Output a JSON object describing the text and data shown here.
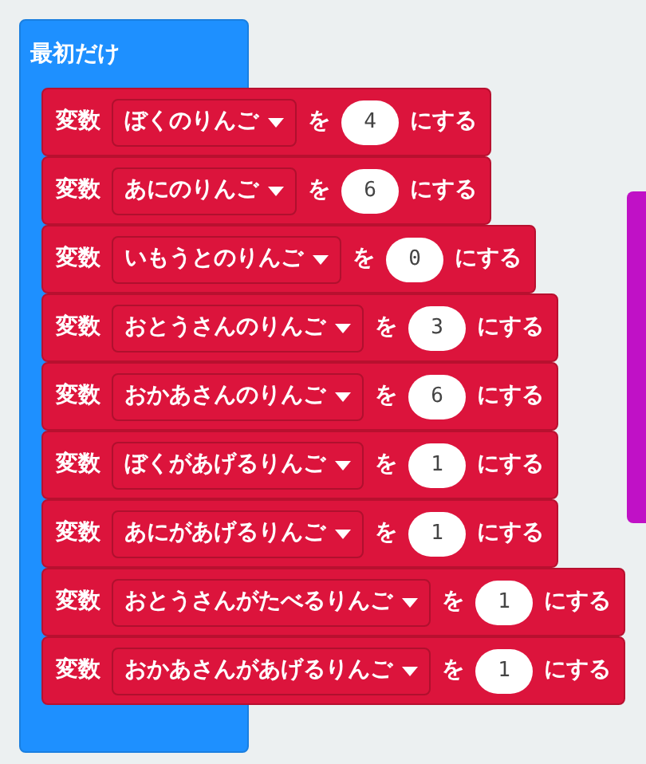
{
  "event_block": {
    "title": "最初だけ"
  },
  "blocks": [
    {
      "keyword": "変数",
      "variable": "ぼくのりんご",
      "particle": "を",
      "value": "4",
      "suffix": "にする"
    },
    {
      "keyword": "変数",
      "variable": "あにのりんご",
      "particle": "を",
      "value": "6",
      "suffix": "にする"
    },
    {
      "keyword": "変数",
      "variable": "いもうとのりんご",
      "particle": "を",
      "value": "0",
      "suffix": "にする"
    },
    {
      "keyword": "変数",
      "variable": "おとうさんのりんご",
      "particle": "を",
      "value": "3",
      "suffix": "にする"
    },
    {
      "keyword": "変数",
      "variable": "おかあさんのりんご",
      "particle": "を",
      "value": "6",
      "suffix": "にする"
    },
    {
      "keyword": "変数",
      "variable": "ぼくがあげるりんご",
      "particle": "を",
      "value": "1",
      "suffix": "にする"
    },
    {
      "keyword": "変数",
      "variable": "あにがあげるりんご",
      "particle": "を",
      "value": "1",
      "suffix": "にする"
    },
    {
      "keyword": "変数",
      "variable": "おとうさんがたべるりんご",
      "particle": "を",
      "value": "1",
      "suffix": "にする"
    },
    {
      "keyword": "変数",
      "variable": "おかあさんがあげるりんご",
      "particle": "を",
      "value": "1",
      "suffix": "にする"
    }
  ]
}
